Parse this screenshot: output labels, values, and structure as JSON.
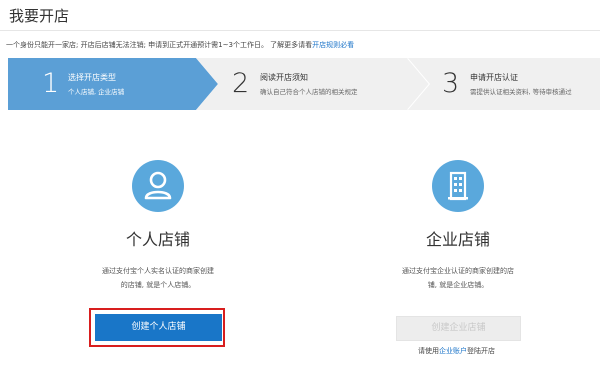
{
  "page": {
    "title": "我要开店"
  },
  "notice": {
    "text": "一个身份只能开一家店; 开店后店铺无法注销; 申请到正式开通预计需1~3个工作日。 了解更多请看",
    "link": "开店规则必看"
  },
  "steps": [
    {
      "num": "1",
      "label": "选择开店类型",
      "sub": "个人店铺, 企业店铺",
      "active": true
    },
    {
      "num": "2",
      "label": "阅读开店须知",
      "sub": "确认自己符合个人店铺的相关规定",
      "active": false
    },
    {
      "num": "3",
      "label": "申请开店认证",
      "sub": "需提供认证相关资料, 等待审核通过",
      "active": false
    }
  ],
  "personal": {
    "icon": "user-icon",
    "title": "个人店铺",
    "desc_line1": "通过支付宝个人实名认证的商家创建",
    "desc_line2": "的店铺, 就是个人店铺。",
    "button": "创建个人店铺"
  },
  "company": {
    "icon": "building-icon",
    "title": "企业店铺",
    "desc_line1": "通过支付宝企业认证的商家创建的店",
    "desc_line2": "铺, 就是企业店铺。",
    "button": "创建企业店铺",
    "hint_prefix": "请使用",
    "hint_link": "企业账户",
    "hint_suffix": "登陆开店"
  },
  "colors": {
    "active_step": "#5b9fd6",
    "inactive_step": "#f0f0f0",
    "primary_button": "#1976c8",
    "highlight_box": "#d81e1e",
    "icon_circle": "#5aa8dc",
    "link": "#1a73c8"
  }
}
